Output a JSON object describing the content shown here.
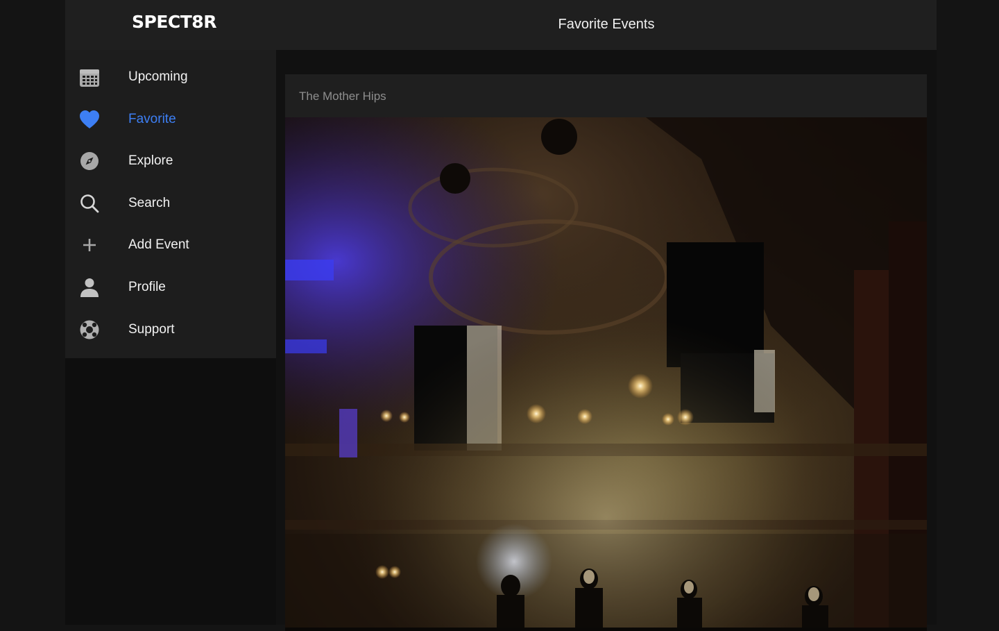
{
  "app": {
    "logo": "SPECT8R",
    "page_title": "Favorite Events"
  },
  "sidebar": {
    "items": [
      {
        "label": "Upcoming",
        "icon": "calendar-icon",
        "active": false
      },
      {
        "label": "Favorite",
        "icon": "heart-icon",
        "active": true
      },
      {
        "label": "Explore",
        "icon": "compass-icon",
        "active": false
      },
      {
        "label": "Search",
        "icon": "search-icon",
        "active": false
      },
      {
        "label": "Add Event",
        "icon": "plus-icon",
        "active": false
      },
      {
        "label": "Profile",
        "icon": "person-icon",
        "active": false
      },
      {
        "label": "Support",
        "icon": "lifebuoy-icon",
        "active": false
      }
    ]
  },
  "event_card": {
    "title": "The Mother Hips",
    "image": "concert-stage-photo"
  },
  "colors": {
    "accent": "#3d7ff4",
    "topbar": "#1f1f1f",
    "sidebar": "#1d1d1d",
    "background": "#0e0e0e"
  }
}
